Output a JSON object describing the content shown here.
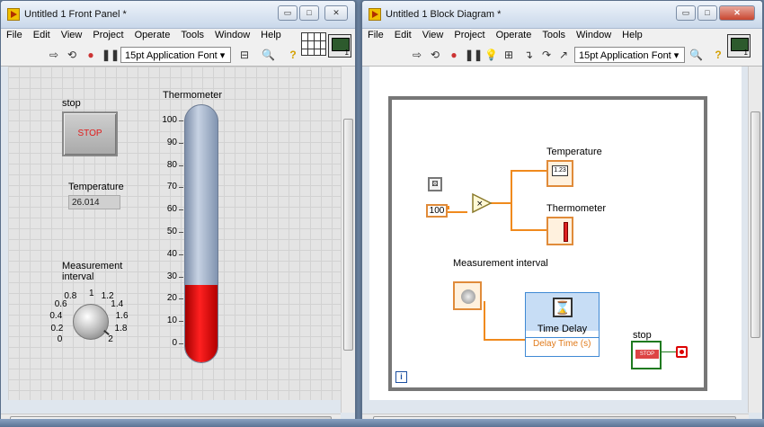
{
  "front_panel": {
    "title": "Untitled 1 Front Panel *",
    "menu": [
      "File",
      "Edit",
      "View",
      "Project",
      "Operate",
      "Tools",
      "Window",
      "Help"
    ],
    "font_selector": "15pt Application Font",
    "stop_label": "stop",
    "stop_button_text": "STOP",
    "temperature_label": "Temperature",
    "temperature_value": "26.014",
    "thermometer_label": "Thermometer",
    "thermometer_scale": [
      "100",
      "90",
      "80",
      "70",
      "60",
      "50",
      "40",
      "30",
      "20",
      "10",
      "0"
    ],
    "thermometer_level": 26.014,
    "knob_label": "Measurement interval",
    "knob_scale": [
      "0",
      "0.2",
      "0.4",
      "0.6",
      "0.8",
      "1",
      "1.2",
      "1.4",
      "1.6",
      "1.8",
      "2"
    ]
  },
  "block_diagram": {
    "title": "Untitled 1 Block Diagram *",
    "menu": [
      "File",
      "Edit",
      "View",
      "Project",
      "Operate",
      "Tools",
      "Window",
      "Help"
    ],
    "font_selector": "15pt Application Font",
    "temperature_label": "Temperature",
    "temperature_terminal": "1.23",
    "thermometer_label": "Thermometer",
    "constant_value": "100",
    "knob_label": "Measurement interval",
    "delay_title": "Time Delay",
    "delay_input": "Delay Time (s)",
    "stop_label": "stop",
    "stop_terminal": "STOP",
    "iteration_symbol": "i"
  }
}
